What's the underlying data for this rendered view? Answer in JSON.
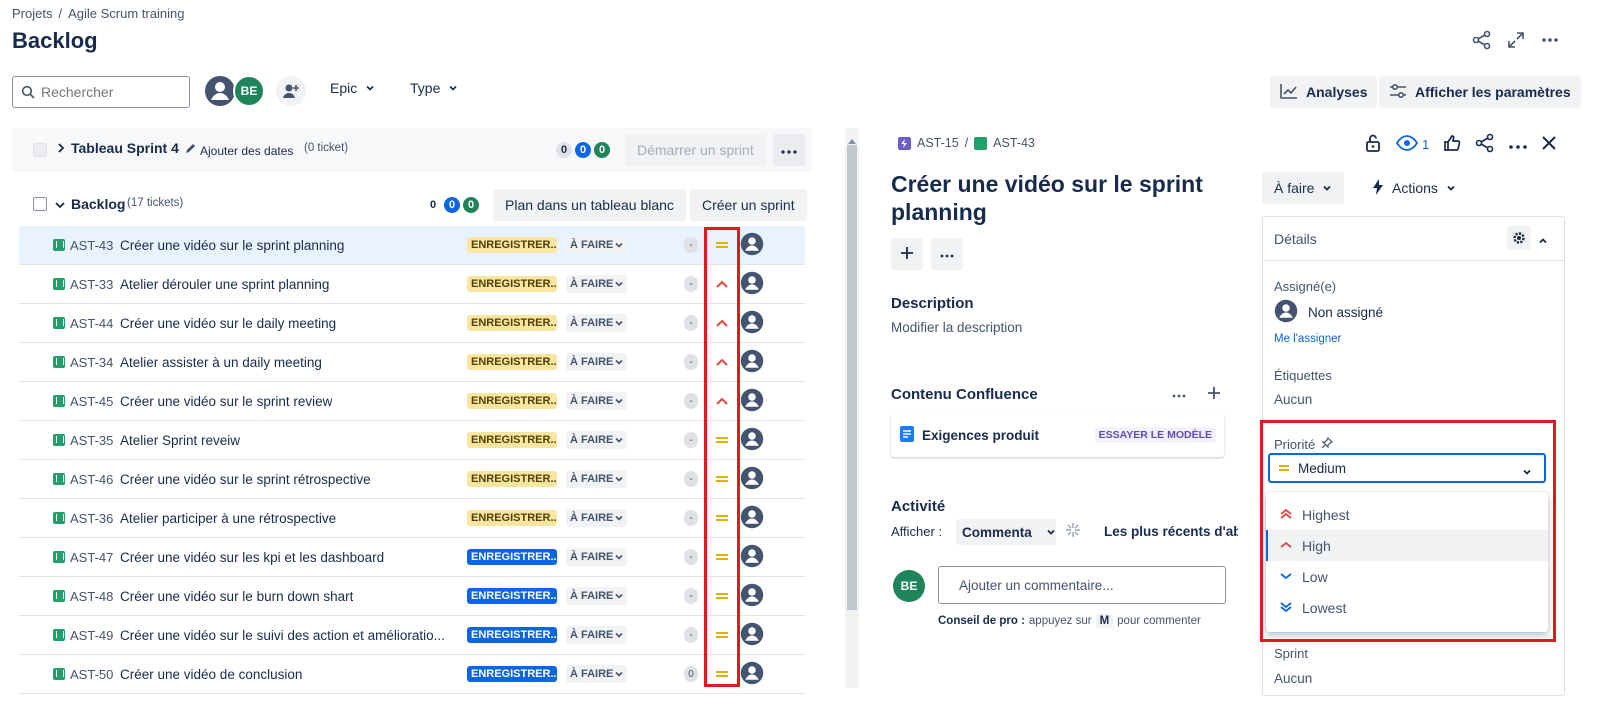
{
  "breadcrumb": {
    "projects": "Projets",
    "sep": "/",
    "project": "Agile Scrum training"
  },
  "page_title": "Backlog",
  "toolbar": {
    "search_placeholder": "Rechercher",
    "avatar_be": "BE",
    "epic_label": "Epic",
    "type_label": "Type",
    "analyses_label": "Analyses",
    "settings_label": "Afficher les paramètres"
  },
  "sprint": {
    "name": "Tableau Sprint 4",
    "add_dates": "Ajouter des dates",
    "tickets": "(0 ticket)",
    "counts": [
      "0",
      "0",
      "0"
    ],
    "start_label": "Démarrer un sprint"
  },
  "backlog": {
    "name": "Backlog",
    "tickets": "(17 tickets)",
    "counts": [
      "0",
      "0",
      "0"
    ],
    "plan_label": "Plan dans un tableau blanc",
    "create_sprint_label": "Créer un sprint"
  },
  "rows": [
    {
      "key": "AST-43",
      "summary": "Créer une vidéo sur le sprint planning",
      "epic": "ENREGISTRER...",
      "epic_color": "yellow",
      "status": "À FAIRE",
      "estimate": "-",
      "priority": "medium"
    },
    {
      "key": "AST-33",
      "summary": "Atelier dérouler une sprint planning",
      "epic": "ENREGISTRER...",
      "epic_color": "yellow",
      "status": "À FAIRE",
      "estimate": "-",
      "priority": "high"
    },
    {
      "key": "AST-44",
      "summary": "Créer une vidéo sur le daily meeting",
      "epic": "ENREGISTRER...",
      "epic_color": "yellow",
      "status": "À FAIRE",
      "estimate": "-",
      "priority": "high"
    },
    {
      "key": "AST-34",
      "summary": "Atelier assister à un daily meeting",
      "epic": "ENREGISTRER...",
      "epic_color": "yellow",
      "status": "À FAIRE",
      "estimate": "-",
      "priority": "high"
    },
    {
      "key": "AST-45",
      "summary": "Créer une vidéo sur le sprint review",
      "epic": "ENREGISTRER...",
      "epic_color": "yellow",
      "status": "À FAIRE",
      "estimate": "-",
      "priority": "high"
    },
    {
      "key": "AST-35",
      "summary": "Atelier Sprint reveiw",
      "epic": "ENREGISTRER...",
      "epic_color": "yellow",
      "status": "À FAIRE",
      "estimate": "-",
      "priority": "medium"
    },
    {
      "key": "AST-46",
      "summary": "Créer une vidéo sur le sprint rétrospective",
      "epic": "ENREGISTRER...",
      "epic_color": "yellow",
      "status": "À FAIRE",
      "estimate": "-",
      "priority": "medium"
    },
    {
      "key": "AST-36",
      "summary": "Atelier participer à une rétrospective",
      "epic": "ENREGISTRER...",
      "epic_color": "yellow",
      "status": "À FAIRE",
      "estimate": "-",
      "priority": "medium"
    },
    {
      "key": "AST-47",
      "summary": "Créer une vidéo sur les kpi et les dashboard",
      "epic": "ENREGISTRER...",
      "epic_color": "blue",
      "status": "À FAIRE",
      "estimate": "-",
      "priority": "medium"
    },
    {
      "key": "AST-48",
      "summary": "Créer une vidéo sur le burn down shart",
      "epic": "ENREGISTRER...",
      "epic_color": "blue",
      "status": "À FAIRE",
      "estimate": "-",
      "priority": "medium"
    },
    {
      "key": "AST-49",
      "summary": "Créer une vidéo sur le suivi des action et amélioratio...",
      "epic": "ENREGISTRER...",
      "epic_color": "blue",
      "status": "À FAIRE",
      "estimate": "-",
      "priority": "medium"
    },
    {
      "key": "AST-50",
      "summary": "Créer une vidéo de conclusion",
      "epic": "ENREGISTRER...",
      "epic_color": "blue",
      "status": "À FAIRE",
      "estimate": "0",
      "priority": "medium"
    }
  ],
  "detail": {
    "parent_key": "AST-15",
    "sep": "/",
    "key": "AST-43",
    "watchers": "1",
    "title": "Créer une vidéo sur le sprint planning",
    "status": "À faire",
    "actions": "Actions",
    "description_h": "Description",
    "description_ph": "Modifier la description",
    "confluence_h": "Contenu Confluence",
    "confluence_item": "Exigences produit",
    "confluence_try": "ESSAYER LE MODÈLE",
    "activity_h": "Activité",
    "show_label": "Afficher :",
    "show_value": "Commenta",
    "sort_label": "Les plus récents d'abc",
    "comment_avatar": "BE",
    "comment_ph": "Ajouter un commentaire...",
    "tip_bold": "Conseil de pro :",
    "tip_text1": "appuyez sur",
    "tip_key": "M",
    "tip_text2": "pour commenter"
  },
  "details_panel": {
    "title": "Détails",
    "assignee_label": "Assigné(e)",
    "assignee_value": "Non assigné",
    "assign_me": "Me l'assigner",
    "labels_label": "Étiquettes",
    "labels_value": "Aucun",
    "priority_label": "Priorité",
    "priority_value": "Medium",
    "priority_options": [
      "Highest",
      "High",
      "Low",
      "Lowest"
    ],
    "sprint_label": "Sprint",
    "sprint_value": "Aucun"
  },
  "colors": {
    "accent": "#0c66e4",
    "highlight_red": "#e0191f",
    "medium": "#e2b203",
    "high": "#e2483d",
    "low": "#0c66e4",
    "story": "#22a06b"
  }
}
